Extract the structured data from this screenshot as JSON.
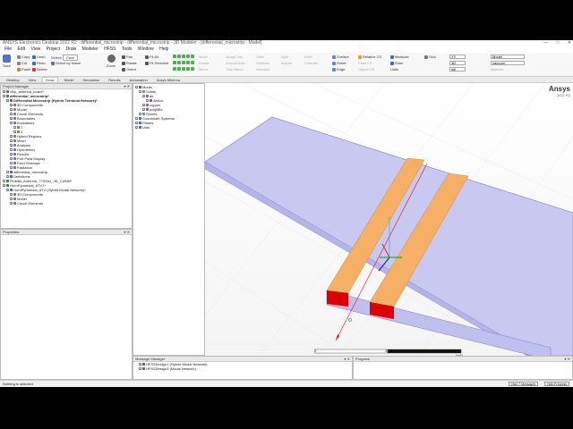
{
  "window": {
    "title": "ANSYS Electronics Desktop 2022 R2 - differential_microstrip - differential_microstrip - 3D Modeler - [differential_microstrip - Model]",
    "controls": [
      "—",
      "□",
      "✕"
    ]
  },
  "menu": [
    "File",
    "Edit",
    "View",
    "Project",
    "Draw",
    "Modeler",
    "HFSS",
    "Tools",
    "Window",
    "Help"
  ],
  "ribbon": {
    "save": "Save",
    "copy": "Copy",
    "cut": "Cut",
    "paste": "Paste",
    "delete": "Delete",
    "undo": "Undo",
    "redo": "Redo",
    "select_label": "Select:",
    "select_value": "Face",
    "select_by_name": "Select by Name",
    "zoom": "Zoom",
    "pan": "Pan",
    "rotate": "Rotate",
    "orient": "Orient",
    "fit_all": "Fit All",
    "fit_selected": "Fit Selected",
    "draw_tools": [
      "Move",
      "Rotate",
      "Mirror",
      "Along Line",
      "Around Axis",
      "Thru Mirror"
    ],
    "boolean_tools": [
      "Unite",
      "Subtract",
      "Intersect",
      "Split",
      "Imprint",
      "Fillet",
      "Chamfer"
    ],
    "surface": "Surface",
    "sheet": "Sheet",
    "edge": "Edge",
    "relative_cs": "Relative CS",
    "face_cs": "Face CS",
    "object_cs": "Object CS",
    "measure": "Measure",
    "ruler": "Ruler",
    "units_label": "Units",
    "units_value": "mil",
    "grid": "Grid",
    "xy_label": "XY",
    "z_label": "3D",
    "model_select": "Model",
    "material_select": "vacuum",
    "material": "Material",
    "val1": "None"
  },
  "tabs": [
    "Desktop",
    "View",
    "Draw",
    "Model",
    "Simulation",
    "Results",
    "Automation",
    "Ansys Minerva"
  ],
  "project_manager": {
    "title": "Project Manager",
    "items": [
      {
        "label": "chip_antenna_board*",
        "level": 0,
        "bold": false
      },
      {
        "label": "differential_microstrip*",
        "level": 0,
        "bold": true
      },
      {
        "label": "Differential Microstrip (Hybrid Terminal Network)*",
        "level": 1,
        "bold": true
      },
      {
        "label": "3D Components",
        "level": 2,
        "bold": false
      },
      {
        "label": "Model",
        "level": 2,
        "bold": false
      },
      {
        "label": "Circuit Elements",
        "level": 2,
        "bold": false
      },
      {
        "label": "Boundaries",
        "level": 2,
        "bold": false
      },
      {
        "label": "Excitations",
        "level": 2,
        "bold": false
      },
      {
        "label": "1",
        "level": 3,
        "bold": false
      },
      {
        "label": "2",
        "level": 3,
        "bold": false
      },
      {
        "label": "Hybrid Regions",
        "level": 2,
        "bold": false
      },
      {
        "label": "Mesh",
        "level": 2,
        "bold": false
      },
      {
        "label": "Analysis",
        "level": 2,
        "bold": false
      },
      {
        "label": "Optimetrics",
        "level": 2,
        "bold": false
      },
      {
        "label": "Results",
        "level": 2,
        "bold": false
      },
      {
        "label": "Port Field Display",
        "level": 2,
        "bold": false
      },
      {
        "label": "Field Overlays",
        "level": 2,
        "bold": false
      },
      {
        "label": "Radiation",
        "level": 2,
        "bold": false
      },
      {
        "label": "differential_microstrip",
        "level": 1,
        "bold": false
      },
      {
        "label": "Definitions",
        "level": 1,
        "bold": false
      },
      {
        "label": "Pinballl_Antenna_770Ghz_3D_CoSiM*",
        "level": 0,
        "bold": false
      },
      {
        "label": "HornPyramidal_ATV1*",
        "level": 0,
        "bold": false
      },
      {
        "label": "HornPyramidal_ATV (Hybrid Modal Network)*",
        "level": 1,
        "bold": false
      },
      {
        "label": "3D Components",
        "level": 2,
        "bold": false
      },
      {
        "label": "Model",
        "level": 2,
        "bold": false
      },
      {
        "label": "Circuit Elements",
        "level": 2,
        "bold": false
      }
    ]
  },
  "properties": {
    "title": "Properties"
  },
  "model_tree": {
    "items": [
      {
        "label": "Model",
        "level": 0
      },
      {
        "label": "Solids",
        "level": 1
      },
      {
        "label": "air",
        "level": 2
      },
      {
        "label": "Airbox",
        "level": 3
      },
      {
        "label": "copper",
        "level": 2
      },
      {
        "label": "polyBBx",
        "level": 2
      },
      {
        "label": "Sheets",
        "level": 1
      },
      {
        "label": "Coordinate Systems",
        "level": 0
      },
      {
        "label": "Planes",
        "level": 0
      },
      {
        "label": "Lists",
        "level": 0
      }
    ]
  },
  "viewport": {
    "brand": "Ansys",
    "version": "2022 R2",
    "scale_labels": [
      "0",
      "35",
      "70 (mil)"
    ]
  },
  "message_manager": {
    "title": "Message Manager",
    "items": [
      "HFSSDesign1 (Hybrid Modal Network)",
      "HFSSDesign3 (Modal Network)"
    ]
  },
  "progress": {
    "title": "Progress"
  },
  "status": {
    "text": "Nothing is selected",
    "hide_messages": "Hide 7 Messages",
    "hide_progress": "Hide Progress"
  },
  "colors": {
    "substrate": "#c8c8f0",
    "trace": "#f5b066",
    "port": "#dd0000",
    "accent": "#1a4fa0"
  }
}
